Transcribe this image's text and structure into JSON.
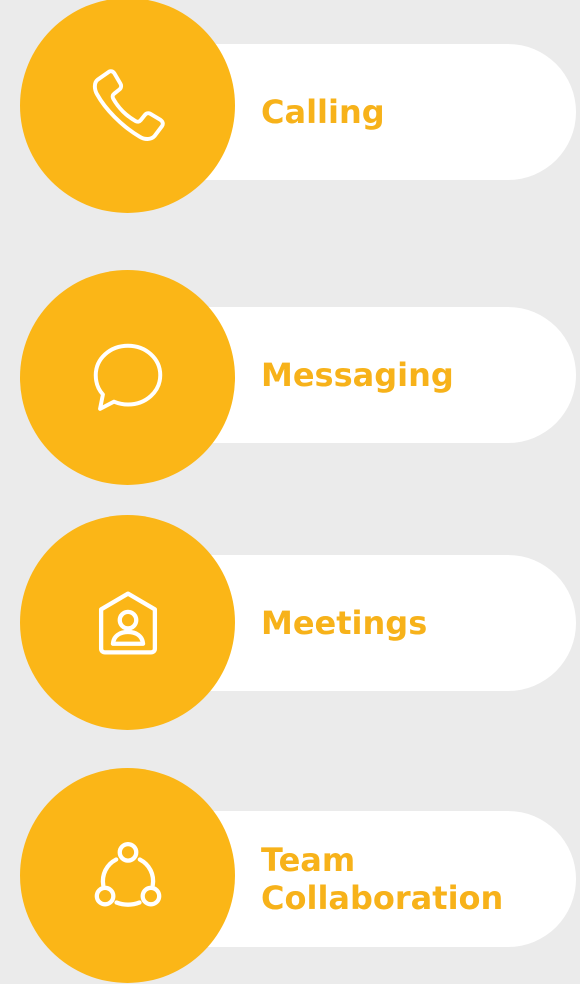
{
  "page": {
    "background_color": "#ebebeb",
    "accent_color": "#fbb617",
    "label_color": "#f7b21a"
  },
  "features": [
    {
      "label": "Calling",
      "icon": "phone-icon"
    },
    {
      "label": "Messaging",
      "icon": "chat-bubble-icon"
    },
    {
      "label": "Meetings",
      "icon": "meeting-room-icon"
    },
    {
      "label": "Team\nCollaboration",
      "icon": "team-collaboration-icon"
    }
  ]
}
